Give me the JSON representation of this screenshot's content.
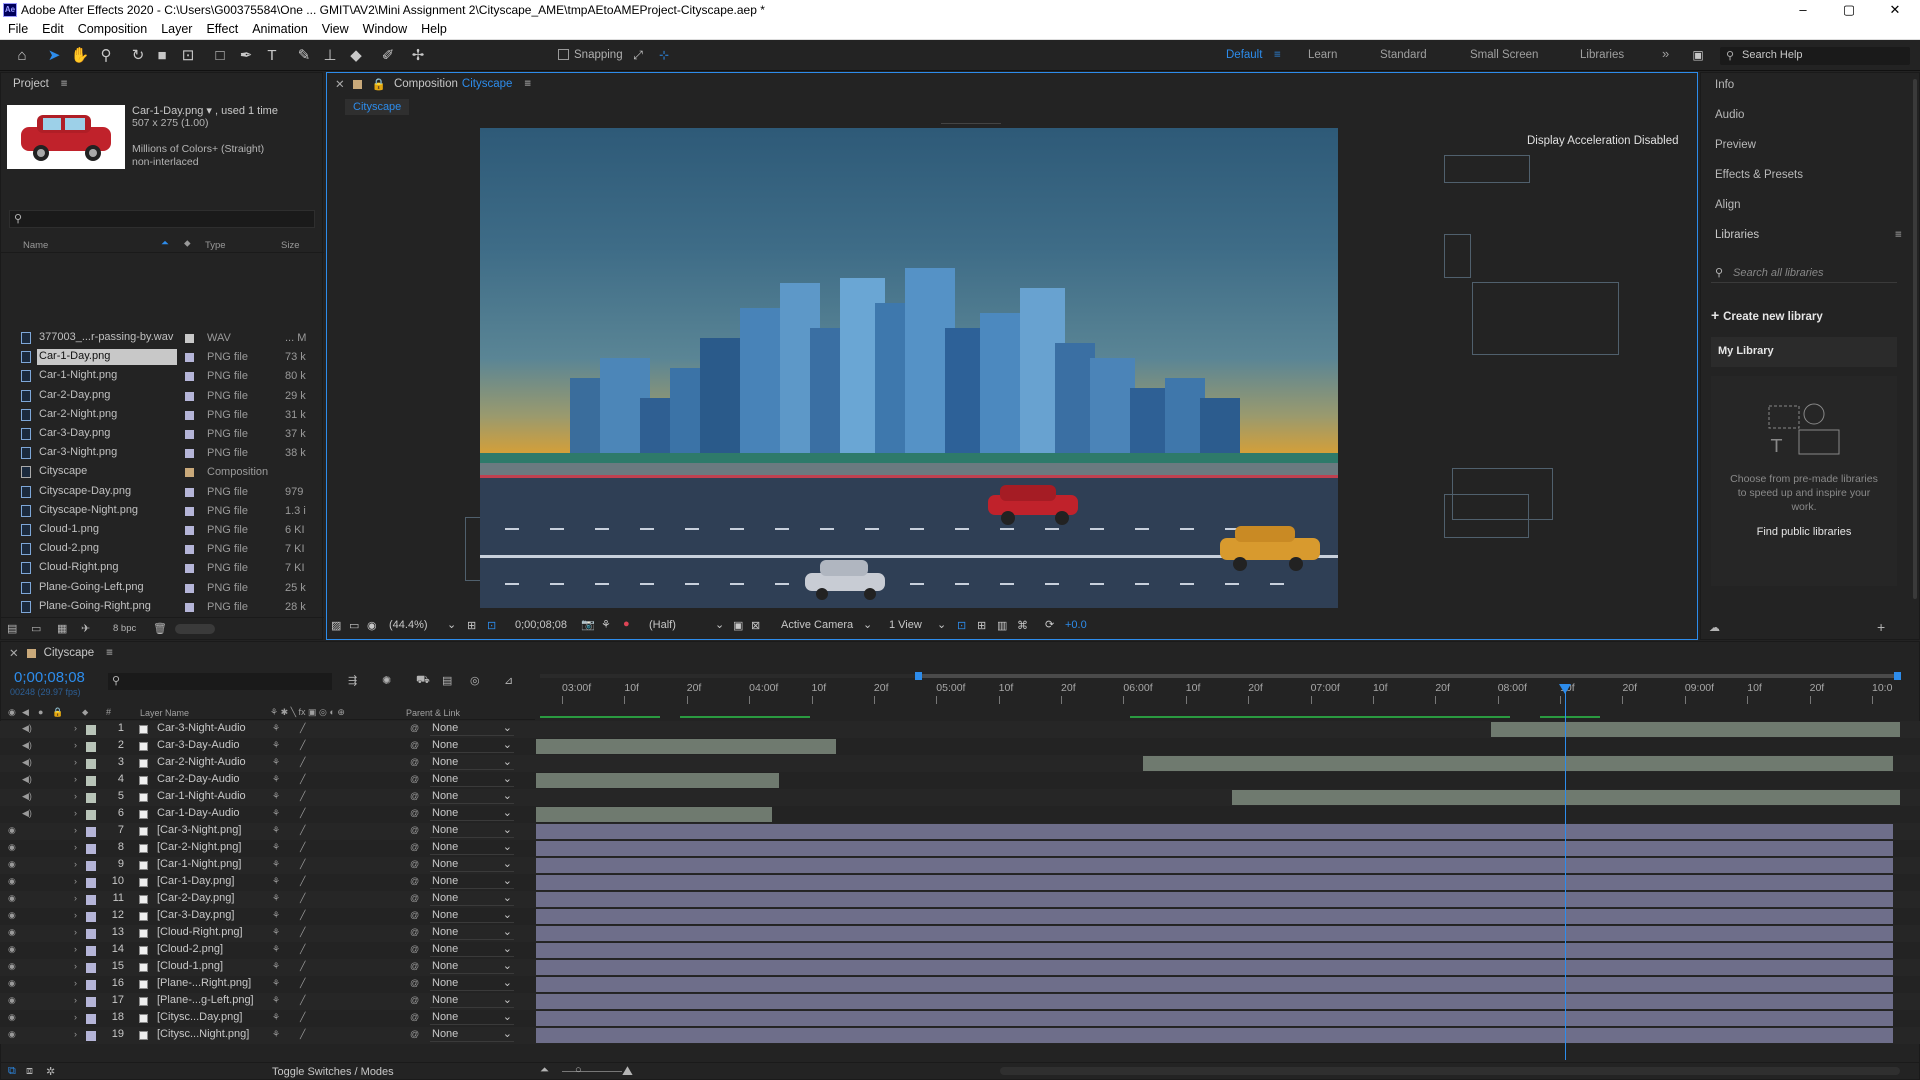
{
  "app": {
    "title": "Adobe After Effects 2020 - C:\\Users\\G00375584\\One ... GMIT\\AV2\\Mini Assignment 2\\Cityscape_AME\\tmpAEtoAMEProject-Cityscape.aep *",
    "logo": "Ae"
  },
  "window_controls": {
    "minimize": "–",
    "maximize": "▢",
    "close": "✕"
  },
  "menu": [
    "File",
    "Edit",
    "Composition",
    "Layer",
    "Effect",
    "Animation",
    "View",
    "Window",
    "Help"
  ],
  "toolbar": {
    "snapping": "Snapping",
    "workspaces": [
      "Default",
      "Learn",
      "Standard",
      "Small Screen",
      "Libraries"
    ],
    "active_workspace": "Default",
    "search": "Search Help",
    "more": "»"
  },
  "project": {
    "title": "Project",
    "item_name": "Car-1-Day.png",
    "used": ", used 1 time",
    "dims": "507 x 275 (1.00)",
    "colors": "Millions of Colors+ (Straight)",
    "interlace": "non-interlaced",
    "search_placeholder": "",
    "columns": {
      "name": "Name",
      "type": "Type",
      "size": "Size"
    },
    "items": [
      {
        "name": "377003_...r-passing-by.wav",
        "type": "WAV",
        "size": "... M",
        "color": "#c8c8c8"
      },
      {
        "name": "Car-1-Day.png",
        "type": "PNG file",
        "size": "73 k",
        "color": "#b5b5d8"
      },
      {
        "name": "Car-1-Night.png",
        "type": "PNG file",
        "size": "80 k",
        "color": "#b5b5d8"
      },
      {
        "name": "Car-2-Day.png",
        "type": "PNG file",
        "size": "29 k",
        "color": "#b5b5d8"
      },
      {
        "name": "Car-2-Night.png",
        "type": "PNG file",
        "size": "31 k",
        "color": "#b5b5d8"
      },
      {
        "name": "Car-3-Day.png",
        "type": "PNG file",
        "size": "37 k",
        "color": "#b5b5d8"
      },
      {
        "name": "Car-3-Night.png",
        "type": "PNG file",
        "size": "38 k",
        "color": "#b5b5d8"
      },
      {
        "name": "Cityscape",
        "type": "Composition",
        "size": "",
        "color": "#c9a97a"
      },
      {
        "name": "Cityscape-Day.png",
        "type": "PNG file",
        "size": "979",
        "color": "#b5b5d8"
      },
      {
        "name": "Cityscape-Night.png",
        "type": "PNG file",
        "size": "1.3 i",
        "color": "#b5b5d8"
      },
      {
        "name": "Cloud-1.png",
        "type": "PNG file",
        "size": "6 KI",
        "color": "#b5b5d8"
      },
      {
        "name": "Cloud-2.png",
        "type": "PNG file",
        "size": "7 KI",
        "color": "#b5b5d8"
      },
      {
        "name": "Cloud-Right.png",
        "type": "PNG file",
        "size": "7 KI",
        "color": "#b5b5d8"
      },
      {
        "name": "Plane-Going-Left.png",
        "type": "PNG file",
        "size": "25 k",
        "color": "#b5b5d8"
      },
      {
        "name": "Plane-Going-Right.png",
        "type": "PNG file",
        "size": "28 k",
        "color": "#b5b5d8"
      }
    ],
    "bpc": "8 bpc"
  },
  "composition": {
    "tab_prefix": "Composition",
    "tab_name": "Cityscape",
    "breadcrumb": "Cityscape",
    "notice": "Display Acceleration Disabled",
    "footer": {
      "zoom": "(44.4%)",
      "timecode": "0;00;08;08",
      "resolution": "(Half)",
      "camera": "Active Camera",
      "views": "1 View",
      "exposure": "+0.0"
    }
  },
  "right_panel": {
    "items": [
      "Info",
      "Audio",
      "Preview",
      "Effects & Presets",
      "Align"
    ],
    "libraries_title": "Libraries",
    "search_placeholder": "Search all libraries",
    "create": "Create new library",
    "my_library": "My Library",
    "hint": "Choose from pre-made libraries to speed up and inspire your work.",
    "find": "Find public libraries"
  },
  "timeline": {
    "comp_name": "Cityscape",
    "timecode": "0;00;08;08",
    "fps": "00248 (29.97 fps)",
    "col_layer": "Layer Name",
    "col_parent": "Parent & Link",
    "toggle": "Toggle Switches / Modes",
    "ruler": [
      "03:00f",
      "10f",
      "20f",
      "04:00f",
      "10f",
      "20f",
      "05:00f",
      "10f",
      "20f",
      "06:00f",
      "10f",
      "20f",
      "07:00f",
      "10f",
      "20f",
      "08:00f",
      "10f",
      "20f",
      "09:00f",
      "10f",
      "20f",
      "10:0"
    ],
    "layers": [
      {
        "num": "1",
        "name": "Car-3-Night-Audio",
        "parent": "None",
        "audio": true,
        "bar_start": 0.7,
        "bar_end": 1.0,
        "color": "#6f7a6f"
      },
      {
        "num": "2",
        "name": "Car-3-Day-Audio",
        "parent": "None",
        "audio": true,
        "bar_start": 0.0,
        "bar_end": 0.22,
        "color": "#6f7a6f"
      },
      {
        "num": "3",
        "name": "Car-2-Night-Audio",
        "parent": "None",
        "audio": true,
        "bar_start": 0.445,
        "bar_end": 0.995,
        "color": "#6f7a6f"
      },
      {
        "num": "4",
        "name": "Car-2-Day-Audio",
        "parent": "None",
        "audio": true,
        "bar_start": 0.0,
        "bar_end": 0.178,
        "color": "#6f7a6f"
      },
      {
        "num": "5",
        "name": "Car-1-Night-Audio",
        "parent": "None",
        "audio": true,
        "bar_start": 0.51,
        "bar_end": 1.0,
        "color": "#6f7a6f"
      },
      {
        "num": "6",
        "name": "Car-1-Day-Audio",
        "parent": "None",
        "audio": true,
        "bar_start": 0.0,
        "bar_end": 0.173,
        "color": "#6f7a6f"
      },
      {
        "num": "7",
        "name": "[Car-3-Night.png]",
        "parent": "None",
        "audio": false,
        "bar_start": 0.0,
        "bar_end": 0.995,
        "color": "#6e6e8a"
      },
      {
        "num": "8",
        "name": "[Car-2-Night.png]",
        "parent": "None",
        "audio": false,
        "bar_start": 0.0,
        "bar_end": 0.995,
        "color": "#6e6e8a"
      },
      {
        "num": "9",
        "name": "[Car-1-Night.png]",
        "parent": "None",
        "audio": false,
        "bar_start": 0.0,
        "bar_end": 0.995,
        "color": "#6e6e8a"
      },
      {
        "num": "10",
        "name": "[Car-1-Day.png]",
        "parent": "None",
        "audio": false,
        "bar_start": 0.0,
        "bar_end": 0.995,
        "color": "#6e6e8a"
      },
      {
        "num": "11",
        "name": "[Car-2-Day.png]",
        "parent": "None",
        "audio": false,
        "bar_start": 0.0,
        "bar_end": 0.995,
        "color": "#6e6e8a"
      },
      {
        "num": "12",
        "name": "[Car-3-Day.png]",
        "parent": "None",
        "audio": false,
        "bar_start": 0.0,
        "bar_end": 0.995,
        "color": "#6e6e8a"
      },
      {
        "num": "13",
        "name": "[Cloud-Right.png]",
        "parent": "None",
        "audio": false,
        "bar_start": 0.0,
        "bar_end": 0.995,
        "color": "#6e6e8a"
      },
      {
        "num": "14",
        "name": "[Cloud-2.png]",
        "parent": "None",
        "audio": false,
        "bar_start": 0.0,
        "bar_end": 0.995,
        "color": "#6e6e8a"
      },
      {
        "num": "15",
        "name": "[Cloud-1.png]",
        "parent": "None",
        "audio": false,
        "bar_start": 0.0,
        "bar_end": 0.995,
        "color": "#6e6e8a"
      },
      {
        "num": "16",
        "name": "[Plane-...Right.png]",
        "parent": "None",
        "audio": false,
        "bar_start": 0.0,
        "bar_end": 0.995,
        "color": "#6e6e8a"
      },
      {
        "num": "17",
        "name": "[Plane-...g-Left.png]",
        "parent": "None",
        "audio": false,
        "bar_start": 0.0,
        "bar_end": 0.995,
        "color": "#6e6e8a"
      },
      {
        "num": "18",
        "name": "[Citysc...Day.png]",
        "parent": "None",
        "audio": false,
        "bar_start": 0.0,
        "bar_end": 0.995,
        "color": "#6e6e8a"
      },
      {
        "num": "19",
        "name": "[Citysc...Night.png]",
        "parent": "None",
        "audio": false,
        "bar_start": 0.0,
        "bar_end": 0.995,
        "color": "#6e6e8a"
      }
    ],
    "playhead_fraction": 0.75
  },
  "colors": {
    "accent": "#2d8ceb",
    "selection": "#2d8ceb"
  }
}
